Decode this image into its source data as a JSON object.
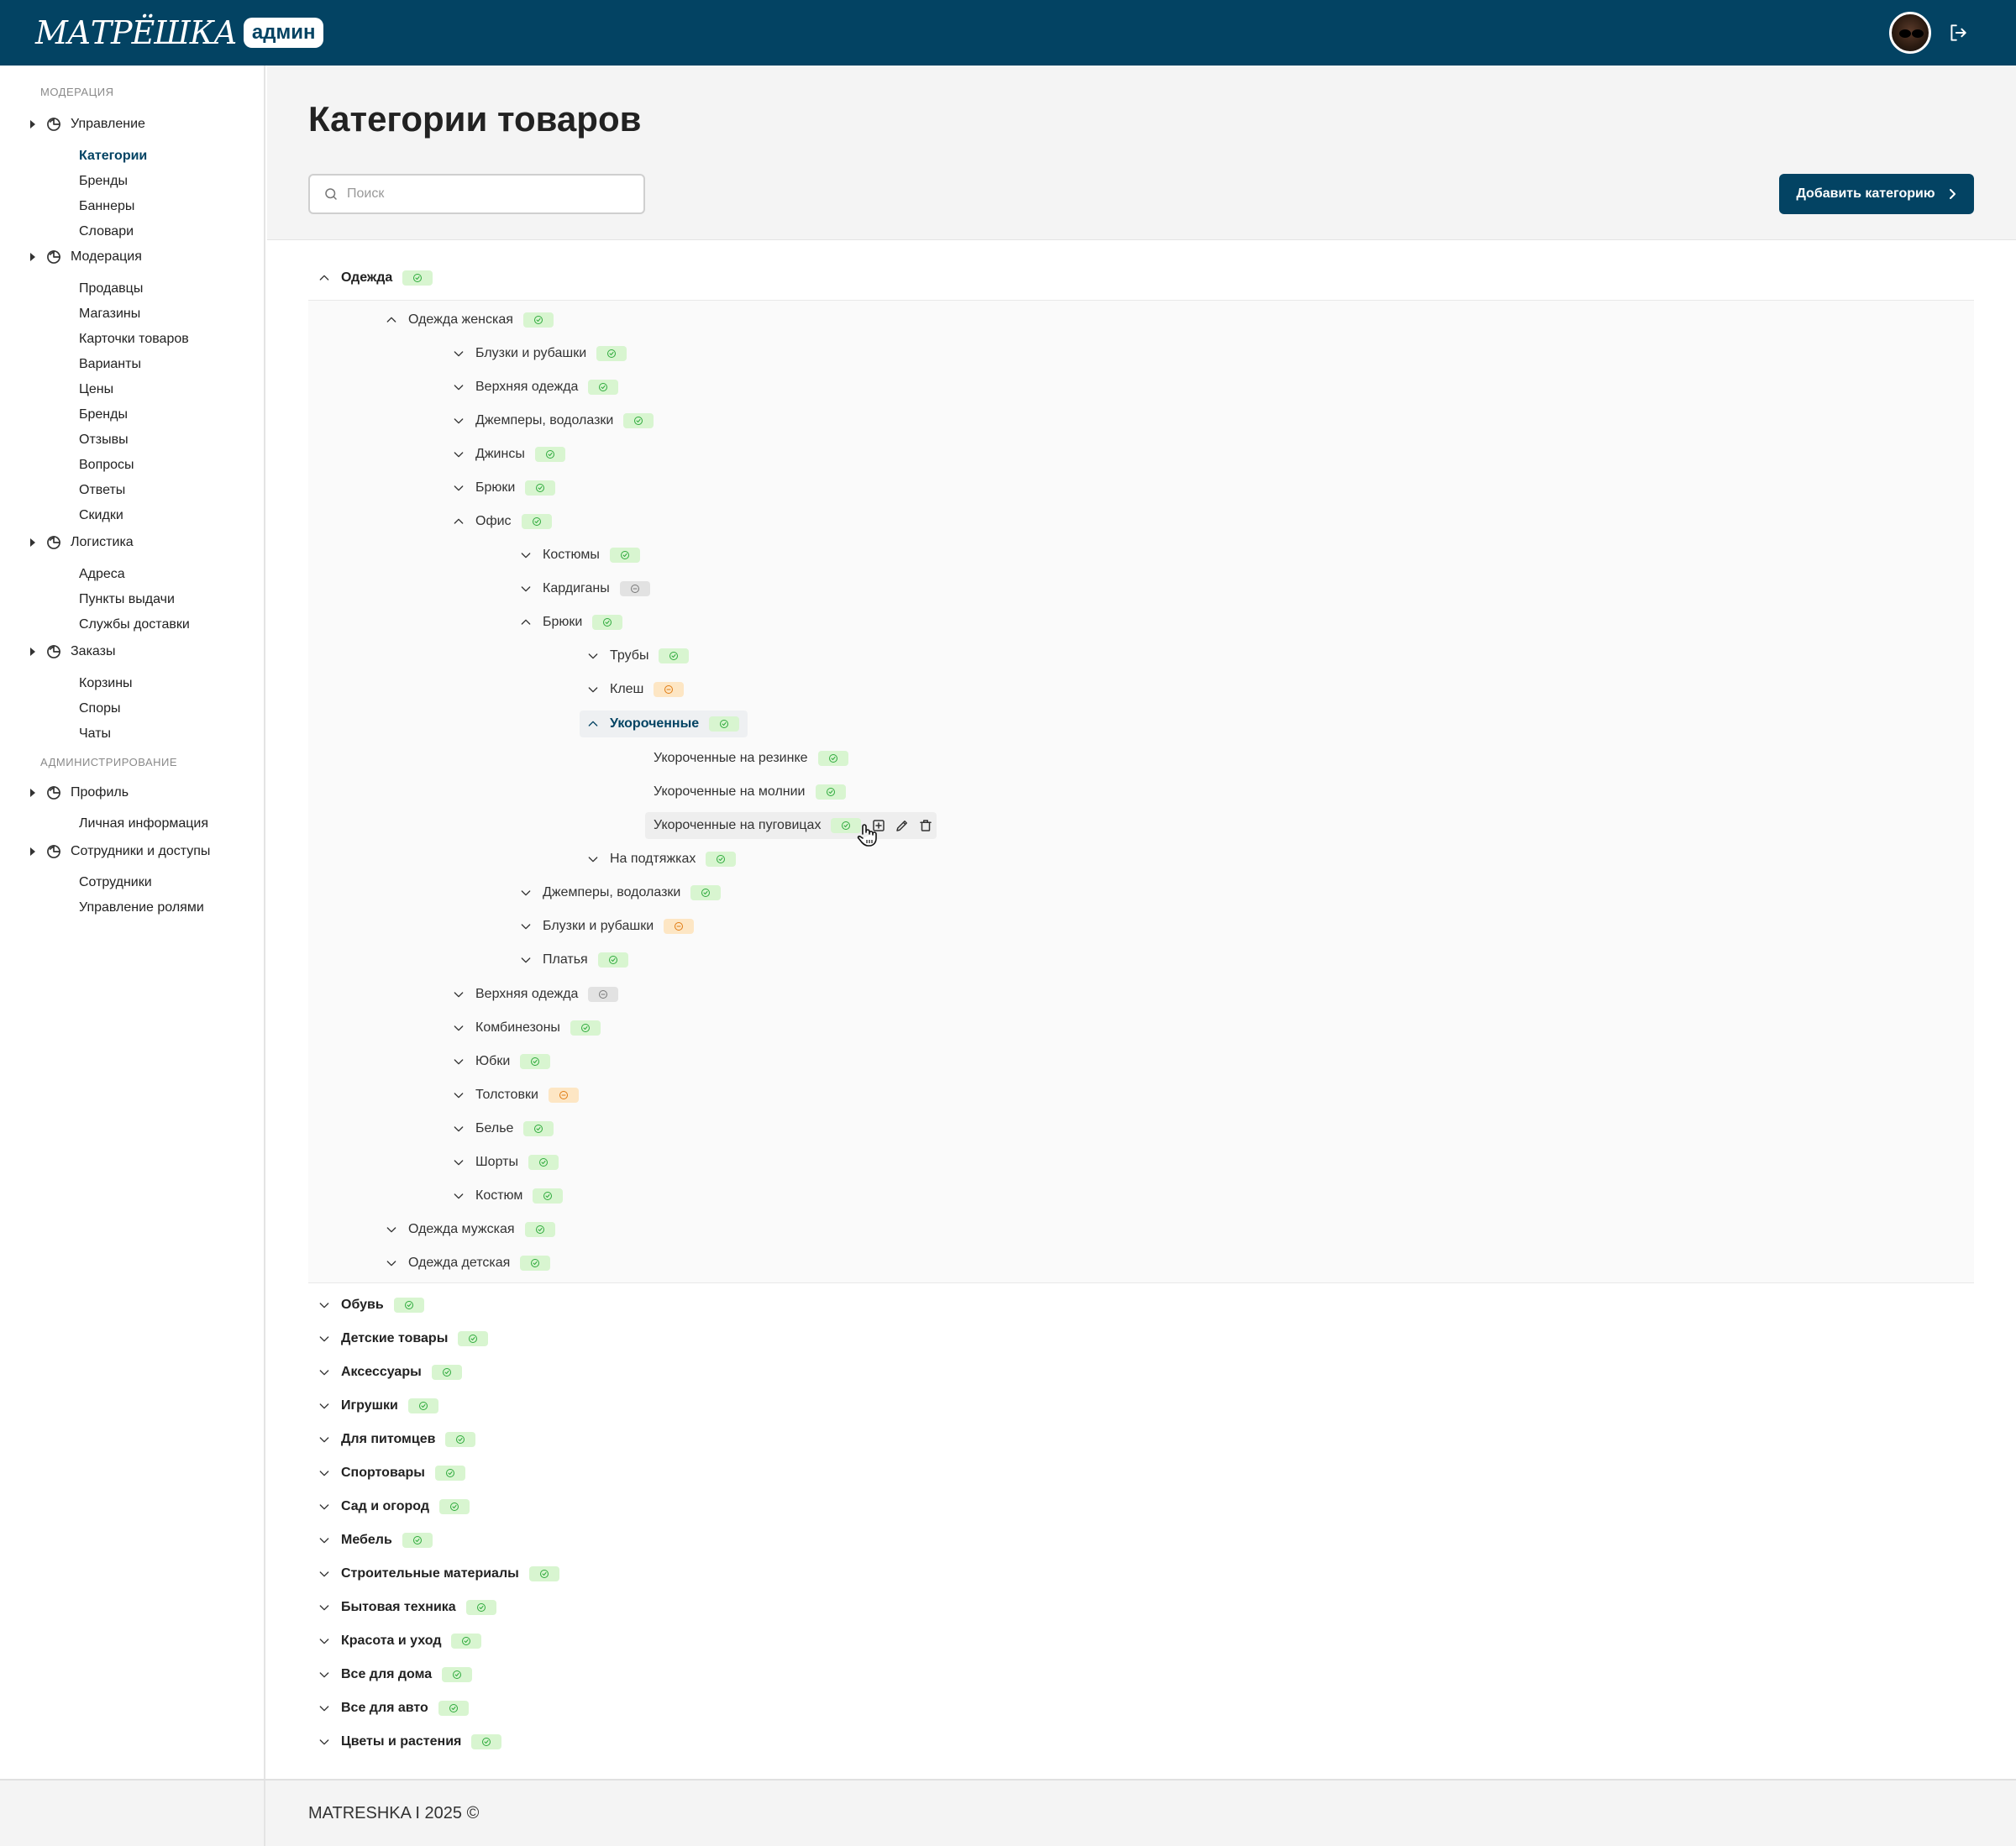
{
  "header": {
    "logo_text": "МАТРЁШКА",
    "logo_badge": "админ"
  },
  "colors": {
    "brand": "#034363",
    "active": "#2eaa3c",
    "inactive": "#888888",
    "pending": "#e07a10"
  },
  "sidebar": {
    "sections": [
      {
        "label": "МОДЕРАЦИЯ"
      },
      {
        "label": "АДМИНИСТРИРОВАНИЕ"
      }
    ],
    "groups": [
      {
        "label": "Управление",
        "icon": "chart-icon",
        "items": [
          "Категории",
          "Бренды",
          "Баннеры",
          "Словари"
        ]
      },
      {
        "label": "Модерация",
        "icon": "chart-icon",
        "items": [
          "Продавцы",
          "Магазины",
          "Карточки товаров",
          "Варианты",
          "Цены",
          "Бренды",
          "Отзывы",
          "Вопросы",
          "Ответы",
          "Скидки"
        ]
      },
      {
        "label": "Логистика",
        "icon": "chart-icon",
        "items": [
          "Адреса",
          "Пункты выдачи",
          "Службы доставки"
        ]
      },
      {
        "label": "Заказы",
        "icon": "chart-icon",
        "items": [
          "Корзины",
          "Споры",
          "Чаты"
        ]
      },
      {
        "label": "Профиль",
        "icon": "chart-icon",
        "items": [
          "Личная информация"
        ]
      },
      {
        "label": "Сотрудники и доступы",
        "icon": "chart-icon",
        "items": [
          "Сотрудники",
          "Управление ролями"
        ]
      }
    ],
    "active_item": "Категории"
  },
  "page": {
    "title": "Категории товаров",
    "search_placeholder": "Поиск",
    "add_button": "Добавить категорию"
  },
  "tree": [
    {
      "label": "Одежда",
      "status": "active",
      "level": 0,
      "expanded": true
    },
    {
      "label": "Одежда женская",
      "status": "active",
      "level": 1,
      "expanded": true
    },
    {
      "label": "Блузки и рубашки",
      "status": "active",
      "level": 2,
      "expanded": false
    },
    {
      "label": "Верхняя одежда",
      "status": "active",
      "level": 2,
      "expanded": false
    },
    {
      "label": "Джемперы, водолазки",
      "status": "active",
      "level": 2,
      "expanded": false
    },
    {
      "label": "Джинсы",
      "status": "active",
      "level": 2,
      "expanded": false
    },
    {
      "label": "Брюки",
      "status": "active",
      "level": 2,
      "expanded": false
    },
    {
      "label": "Офис",
      "status": "active",
      "level": 2,
      "expanded": true
    },
    {
      "label": "Костюмы",
      "status": "active",
      "level": 3,
      "expanded": false
    },
    {
      "label": "Кардиганы",
      "status": "inactive",
      "level": 3,
      "expanded": false
    },
    {
      "label": "Брюки",
      "status": "active",
      "level": 3,
      "expanded": true
    },
    {
      "label": "Трубы",
      "status": "active",
      "level": 4,
      "expanded": false
    },
    {
      "label": "Клеш",
      "status": "pending",
      "level": 4,
      "expanded": false
    },
    {
      "label": "Укороченные",
      "status": "active",
      "level": 4,
      "expanded": true,
      "selected": true
    },
    {
      "label": "Укороченные на резинке",
      "status": "active",
      "level": 5,
      "leaf": true
    },
    {
      "label": "Укороченные на молнии",
      "status": "active",
      "level": 5,
      "leaf": true
    },
    {
      "label": "Укороченные на пуговицах",
      "status": "active",
      "level": 5,
      "leaf": true,
      "hovered": true
    },
    {
      "label": "На подтяжках",
      "status": "active",
      "level": 4,
      "expanded": false
    },
    {
      "label": "Джемперы, водолазки",
      "status": "active",
      "level": 3,
      "expanded": false
    },
    {
      "label": "Блузки и рубашки",
      "status": "pending",
      "level": 3,
      "expanded": false
    },
    {
      "label": "Платья",
      "status": "active",
      "level": 3,
      "expanded": false
    },
    {
      "label": "Верхняя одежда",
      "status": "inactive",
      "level": 2,
      "expanded": false
    },
    {
      "label": "Комбинезоны",
      "status": "active",
      "level": 2,
      "expanded": false
    },
    {
      "label": "Юбки",
      "status": "active",
      "level": 2,
      "expanded": false
    },
    {
      "label": "Толстовки",
      "status": "pending",
      "level": 2,
      "expanded": false
    },
    {
      "label": "Белье",
      "status": "active",
      "level": 2,
      "expanded": false
    },
    {
      "label": "Шорты",
      "status": "active",
      "level": 2,
      "expanded": false
    },
    {
      "label": "Костюм",
      "status": "active",
      "level": 2,
      "expanded": false
    },
    {
      "label": "Одежда мужская",
      "status": "active",
      "level": 1,
      "expanded": false
    },
    {
      "label": "Одежда детская",
      "status": "active",
      "level": 1,
      "expanded": false
    },
    {
      "label": "Обувь",
      "status": "active",
      "level": 0,
      "expanded": false
    },
    {
      "label": "Детские товары",
      "status": "active",
      "level": 0,
      "expanded": false
    },
    {
      "label": "Аксессуары",
      "status": "active",
      "level": 0,
      "expanded": false
    },
    {
      "label": "Игрушки",
      "status": "active",
      "level": 0,
      "expanded": false
    },
    {
      "label": "Для питомцев",
      "status": "active",
      "level": 0,
      "expanded": false
    },
    {
      "label": "Спортовары",
      "status": "active",
      "level": 0,
      "expanded": false
    },
    {
      "label": "Сад и огород",
      "status": "active",
      "level": 0,
      "expanded": false
    },
    {
      "label": "Мебель",
      "status": "active",
      "level": 0,
      "expanded": false
    },
    {
      "label": "Строительные материалы",
      "status": "active",
      "level": 0,
      "expanded": false
    },
    {
      "label": "Бытовая техника",
      "status": "active",
      "level": 0,
      "expanded": false
    },
    {
      "label": "Красота и уход",
      "status": "active",
      "level": 0,
      "expanded": false
    },
    {
      "label": "Все для дома",
      "status": "active",
      "level": 0,
      "expanded": false
    },
    {
      "label": "Все для авто",
      "status": "active",
      "level": 0,
      "expanded": false
    },
    {
      "label": "Цветы и растения",
      "status": "active",
      "level": 0,
      "expanded": false
    }
  ],
  "footer": {
    "text": "MATRESHKA I 2025 ©"
  }
}
